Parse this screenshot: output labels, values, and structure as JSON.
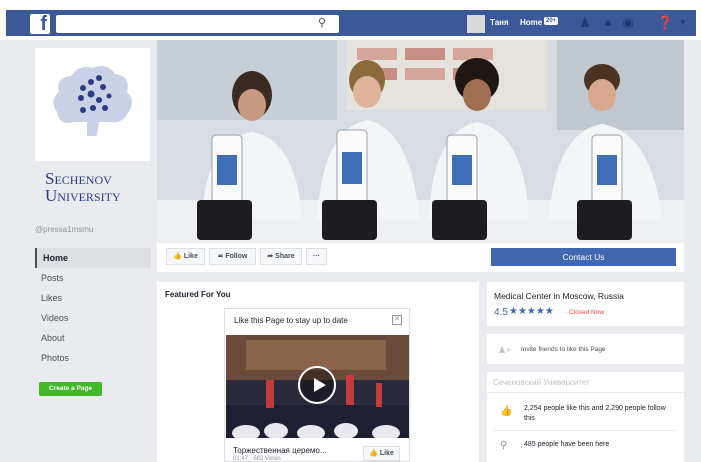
{
  "topbar": {
    "logo": "f",
    "search_placeholder": "",
    "user_name": "Таня",
    "home_label": "Home",
    "home_badge": "20+",
    "icons": [
      "friends-icon",
      "messenger-icon",
      "globe-icon",
      "help-icon"
    ],
    "brand_color": "#3b5998"
  },
  "page": {
    "name_line1": "Sechenov",
    "name_line2": "University",
    "handle": "@pressa1msmu",
    "nav": [
      "Home",
      "Posts",
      "Likes",
      "Videos",
      "About",
      "Photos"
    ],
    "create_page": "Create a Page"
  },
  "actions": {
    "like": "Like",
    "follow": "Follow",
    "share": "Share",
    "more": "···",
    "contact": "Contact Us"
  },
  "featured": {
    "title": "Featured For You",
    "card_title": "Like this Page to stay up to date",
    "video_title": "Торжественная церемо...",
    "video_meta": "01:47 · 682 Views",
    "like_button": "Like"
  },
  "about": {
    "category": "Medical Center in Moscow, Russia",
    "rating": "4.5",
    "stars": "★★★★★",
    "status": "· Closed Now",
    "invite": "Invite friends to like this Page",
    "section_title": "Сеченовский Университет",
    "likes": "2,254 people like this and 2,290 people follow this",
    "been_here": "485 people have been here"
  }
}
